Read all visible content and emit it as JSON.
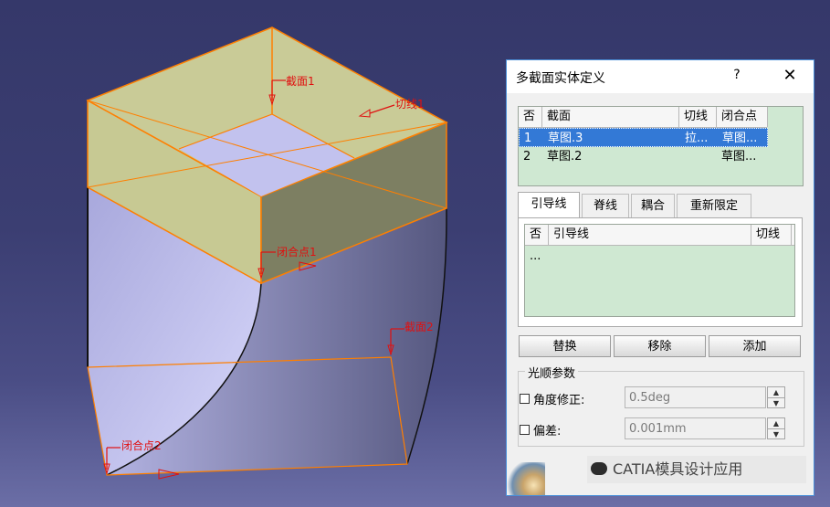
{
  "viewport": {
    "labels": {
      "section1": "截面1",
      "tangent1": "切线1",
      "closing1": "闭合点1",
      "section2": "截面2",
      "closing2": "闭合点2"
    },
    "colors": {
      "top_fill": "#c8c896",
      "edge": "#ff7f00",
      "body_light": "#c6c6f2",
      "body_dark": "#5c5e8a",
      "annotation": "#e01010"
    }
  },
  "dialog": {
    "title": "多截面实体定义",
    "help": "?",
    "close": "✕",
    "sections_table": {
      "headers": [
        "否",
        "截面",
        "切线",
        "闭合点"
      ],
      "rows": [
        {
          "no": "1",
          "section": "草图.3",
          "tangent": "拉...",
          "closing": "草图...",
          "selected": true
        },
        {
          "no": "2",
          "section": "草图.2",
          "tangent": "",
          "closing": "草图...",
          "selected": false
        }
      ]
    },
    "tabs": [
      "引导线",
      "脊线",
      "耦合",
      "重新限定"
    ],
    "guides_table": {
      "headers": [
        "否",
        "引导线",
        "切线"
      ],
      "rows": [
        {
          "no": "..."
        }
      ]
    },
    "buttons": {
      "replace": "替换",
      "remove": "移除",
      "add": "添加"
    },
    "smooth": {
      "title": "光顺参数",
      "angle_label": "角度修正:",
      "angle_value": "0.5deg",
      "deviation_label": "偏差:",
      "deviation_value": "0.001mm"
    },
    "watermark": "CATIA模具设计应用"
  }
}
